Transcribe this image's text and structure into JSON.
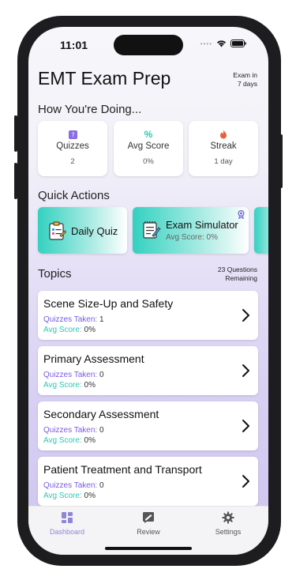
{
  "status": {
    "time": "11:01"
  },
  "header": {
    "title": "EMT Exam Prep",
    "exam_in_line1": "Exam in",
    "exam_in_line2": "7 days"
  },
  "stats_section": {
    "title": "How You're Doing...",
    "cards": [
      {
        "label": "Quizzes",
        "value": "2",
        "icon": "quiz-icon",
        "color": "#8a6be8"
      },
      {
        "label": "Avg Score",
        "value": "0%",
        "icon": "percent-icon",
        "color": "#2cc7b6"
      },
      {
        "label": "Streak",
        "value": "1 day",
        "icon": "flame-icon",
        "color": "#e8603c"
      }
    ]
  },
  "quick_actions": {
    "title": "Quick Actions",
    "items": [
      {
        "label": "Daily Quiz",
        "icon": "clipboard-icon"
      },
      {
        "label": "Exam Simulator",
        "sub": "Avg Score: 0%",
        "icon": "notepad-icon",
        "badge": "award-icon"
      }
    ]
  },
  "topics": {
    "title": "Topics",
    "remaining_line1": "23 Questions",
    "remaining_line2": "Remaining",
    "quizzes_label": "Quizzes Taken:",
    "avg_label": "Avg Score:",
    "items": [
      {
        "name": "Scene Size-Up and Safety",
        "quizzes": "1",
        "avg": "0%"
      },
      {
        "name": "Primary Assessment",
        "quizzes": "0",
        "avg": "0%"
      },
      {
        "name": "Secondary Assessment",
        "quizzes": "0",
        "avg": "0%"
      },
      {
        "name": "Patient Treatment and Transport",
        "quizzes": "0",
        "avg": "0%"
      }
    ]
  },
  "tabbar": {
    "items": [
      {
        "label": "Dashboard",
        "icon": "dashboard-icon",
        "active": true
      },
      {
        "label": "Review",
        "icon": "review-icon",
        "active": false
      },
      {
        "label": "Settings",
        "icon": "gear-icon",
        "active": false
      }
    ],
    "active_color": "#8f86d6",
    "inactive_color": "#555555"
  }
}
